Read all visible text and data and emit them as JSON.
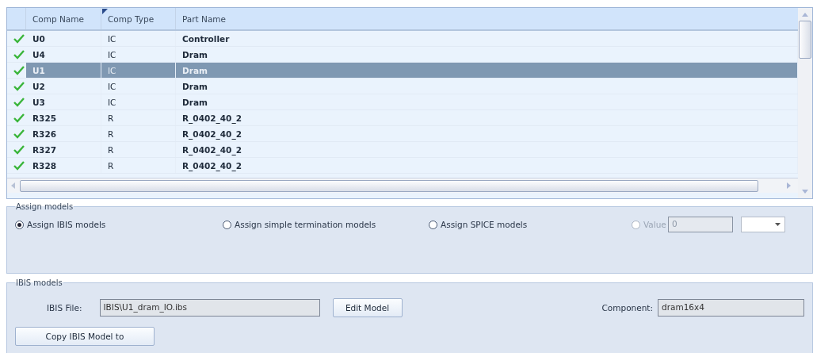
{
  "table": {
    "columns": [
      {
        "label": "Comp Name",
        "sorted": false
      },
      {
        "label": "Comp Type",
        "sorted": true
      },
      {
        "label": "Part Name",
        "sorted": false
      }
    ],
    "rows": [
      {
        "name": "U0",
        "type": "IC",
        "part": "Controller",
        "checked": true,
        "selected": false
      },
      {
        "name": "U4",
        "type": "IC",
        "part": "Dram",
        "checked": true,
        "selected": false
      },
      {
        "name": "U1",
        "type": "IC",
        "part": "Dram",
        "checked": true,
        "selected": true
      },
      {
        "name": "U2",
        "type": "IC",
        "part": "Dram",
        "checked": true,
        "selected": false
      },
      {
        "name": "U3",
        "type": "IC",
        "part": "Dram",
        "checked": true,
        "selected": false
      },
      {
        "name": "R325",
        "type": "R",
        "part": "R_0402_40_2",
        "checked": true,
        "selected": false
      },
      {
        "name": "R326",
        "type": "R",
        "part": "R_0402_40_2",
        "checked": true,
        "selected": false
      },
      {
        "name": "R327",
        "type": "R",
        "part": "R_0402_40_2",
        "checked": true,
        "selected": false
      },
      {
        "name": "R328",
        "type": "R",
        "part": "R_0402_40_2",
        "checked": true,
        "selected": false
      }
    ]
  },
  "assign_models": {
    "title": "Assign models",
    "options": [
      {
        "label": "Assign IBIS models",
        "selected": true,
        "disabled": false
      },
      {
        "label": "Assign simple termination models",
        "selected": false,
        "disabled": false
      },
      {
        "label": "Assign SPICE models",
        "selected": false,
        "disabled": false
      },
      {
        "label": "Value",
        "selected": false,
        "disabled": true
      }
    ],
    "value_field": {
      "value": "0",
      "disabled": true
    }
  },
  "ibis_models": {
    "title": "IBIS models",
    "file_label": "IBIS File:",
    "file_value": "IBIS\\U1_dram_IO.ibs",
    "edit_button": "Edit Model",
    "component_label": "Component:",
    "component_value": "dram16x4",
    "copy_button": "Copy IBIS Model to"
  }
}
